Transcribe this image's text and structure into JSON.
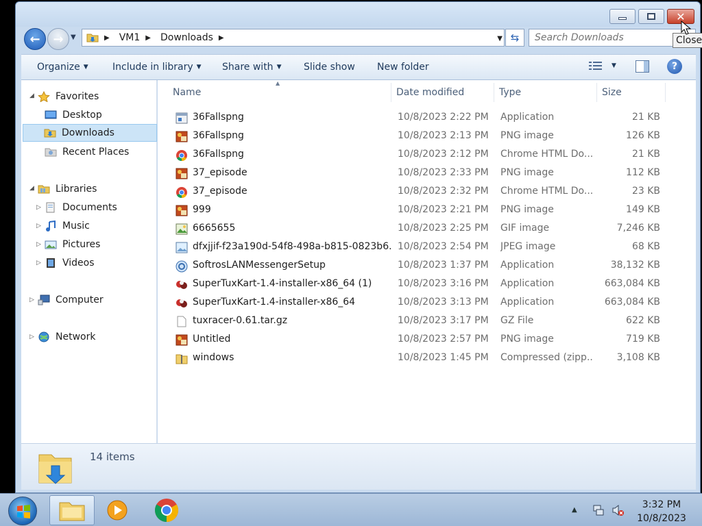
{
  "window": {
    "controls": {
      "minimize": "minimize",
      "maximize": "maximize",
      "close": "close"
    },
    "tooltip": "Close"
  },
  "address": {
    "crumbs": [
      "VM1",
      "Downloads"
    ],
    "search_placeholder": "Search Downloads"
  },
  "toolbar": {
    "organize": "Organize",
    "include_in_library": "Include in library",
    "share_with": "Share with",
    "slide_show": "Slide show",
    "new_folder": "New folder"
  },
  "navpane": {
    "favorites": "Favorites",
    "desktop": "Desktop",
    "downloads": "Downloads",
    "recent_places": "Recent Places",
    "libraries": "Libraries",
    "documents": "Documents",
    "music": "Music",
    "pictures": "Pictures",
    "videos": "Videos",
    "computer": "Computer",
    "network": "Network"
  },
  "columns": {
    "name": "Name",
    "date": "Date modified",
    "type": "Type",
    "size": "Size"
  },
  "files": [
    {
      "name": "36Fallspng",
      "date": "10/8/2023 2:22 PM",
      "type": "Application",
      "size": "21 KB",
      "icon": "app-icon"
    },
    {
      "name": "36Fallspng",
      "date": "10/8/2023 2:13 PM",
      "type": "PNG image",
      "size": "126 KB",
      "icon": "png-icon"
    },
    {
      "name": "36Fallspng",
      "date": "10/8/2023 2:12 PM",
      "type": "Chrome HTML Do...",
      "size": "21 KB",
      "icon": "chrome-icon"
    },
    {
      "name": "37_episode",
      "date": "10/8/2023 2:33 PM",
      "type": "PNG image",
      "size": "112 KB",
      "icon": "png-icon"
    },
    {
      "name": "37_episode",
      "date": "10/8/2023 2:32 PM",
      "type": "Chrome HTML Do...",
      "size": "23 KB",
      "icon": "chrome-icon"
    },
    {
      "name": "999",
      "date": "10/8/2023 2:21 PM",
      "type": "PNG image",
      "size": "149 KB",
      "icon": "png-icon"
    },
    {
      "name": "6665655",
      "date": "10/8/2023 2:25 PM",
      "type": "GIF image",
      "size": "7,246 KB",
      "icon": "gif-icon"
    },
    {
      "name": "dfxjjif-f23a190d-54f8-498a-b815-0823b6...",
      "date": "10/8/2023 2:54 PM",
      "type": "JPEG image",
      "size": "68 KB",
      "icon": "jpeg-icon"
    },
    {
      "name": "SoftrosLANMessengerSetup",
      "date": "10/8/2023 1:37 PM",
      "type": "Application",
      "size": "38,132 KB",
      "icon": "setup-icon"
    },
    {
      "name": "SuperTuxKart-1.4-installer-x86_64 (1)",
      "date": "10/8/2023 3:16 PM",
      "type": "Application",
      "size": "663,084 KB",
      "icon": "kart-icon"
    },
    {
      "name": "SuperTuxKart-1.4-installer-x86_64",
      "date": "10/8/2023 3:13 PM",
      "type": "Application",
      "size": "663,084 KB",
      "icon": "kart-icon"
    },
    {
      "name": "tuxracer-0.61.tar.gz",
      "date": "10/8/2023 3:17 PM",
      "type": "GZ File",
      "size": "622 KB",
      "icon": "blank-file-icon"
    },
    {
      "name": "Untitled",
      "date": "10/8/2023 2:57 PM",
      "type": "PNG image",
      "size": "719 KB",
      "icon": "png-icon"
    },
    {
      "name": "windows",
      "date": "10/8/2023 1:45 PM",
      "type": "Compressed (zipp...",
      "size": "3,108 KB",
      "icon": "zip-folder-icon"
    }
  ],
  "status": {
    "count": "14 items"
  },
  "taskbar": {
    "clock_time": "3:32 PM",
    "clock_date": "10/8/2023"
  }
}
